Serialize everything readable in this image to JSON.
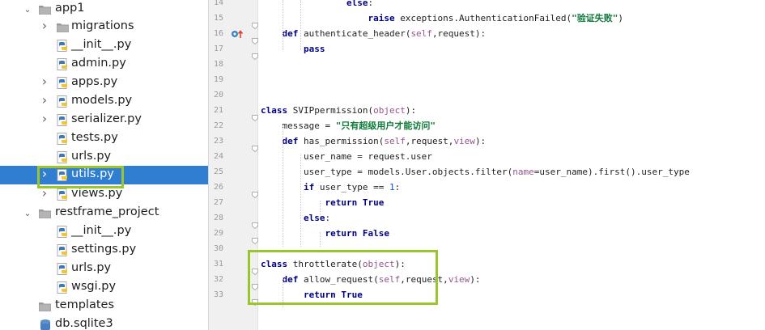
{
  "tree": {
    "items": [
      {
        "label": "app1",
        "icon": "folder-icon",
        "chevron": "expanded"
      },
      {
        "label": "migrations",
        "icon": "folder-icon",
        "chevron": "collapsed"
      },
      {
        "label": "__init__.py",
        "icon": "python-file-icon",
        "chevron": "none"
      },
      {
        "label": "admin.py",
        "icon": "python-file-icon",
        "chevron": "none"
      },
      {
        "label": "apps.py",
        "icon": "python-file-icon",
        "chevron": "collapsed"
      },
      {
        "label": "models.py",
        "icon": "python-file-icon",
        "chevron": "collapsed"
      },
      {
        "label": "serializer.py",
        "icon": "python-file-icon",
        "chevron": "collapsed"
      },
      {
        "label": "tests.py",
        "icon": "python-file-icon",
        "chevron": "none"
      },
      {
        "label": "urls.py",
        "icon": "python-file-icon",
        "chevron": "none"
      },
      {
        "label": "utils.py",
        "icon": "python-file-icon",
        "chevron": "collapsed",
        "selected": true
      },
      {
        "label": "views.py",
        "icon": "python-file-icon",
        "chevron": "collapsed"
      },
      {
        "label": "restframe_project",
        "icon": "folder-icon",
        "chevron": "expanded"
      },
      {
        "label": "__init__.py",
        "icon": "python-file-icon",
        "chevron": "none"
      },
      {
        "label": "settings.py",
        "icon": "python-file-icon",
        "chevron": "none"
      },
      {
        "label": "urls.py",
        "icon": "python-file-icon",
        "chevron": "none"
      },
      {
        "label": "wsgi.py",
        "icon": "python-file-icon",
        "chevron": "none"
      },
      {
        "label": "templates",
        "icon": "folder-icon",
        "chevron": "none"
      },
      {
        "label": "db.sqlite3",
        "icon": "database-icon",
        "chevron": "none"
      }
    ]
  },
  "editor": {
    "lines": [
      {
        "n": "14",
        "indent": 0,
        "tokens": [
          {
            "t": "                else",
            "c": "kw"
          },
          {
            "t": ":",
            "c": ""
          }
        ]
      },
      {
        "n": "15",
        "indent": 0,
        "tokens": [
          {
            "t": "                    raise ",
            "c": "kw"
          },
          {
            "t": "exceptions.AuthenticationFailed(",
            "c": ""
          },
          {
            "t": "\"验证失败\"",
            "c": "str"
          },
          {
            "t": ")",
            "c": ""
          }
        ]
      },
      {
        "n": "16",
        "indent": 0,
        "tokens": [
          {
            "t": "    def ",
            "c": "kw"
          },
          {
            "t": "authenticate_header(",
            "c": ""
          },
          {
            "t": "self",
            "c": "param"
          },
          {
            "t": ",request):",
            "c": ""
          }
        ]
      },
      {
        "n": "17",
        "indent": 0,
        "tokens": [
          {
            "t": "        pass",
            "c": "kw"
          }
        ]
      },
      {
        "n": "18",
        "indent": 0,
        "tokens": []
      },
      {
        "n": "19",
        "indent": 0,
        "tokens": []
      },
      {
        "n": "20",
        "indent": 0,
        "tokens": []
      },
      {
        "n": "21",
        "indent": 0,
        "tokens": [
          {
            "t": "class ",
            "c": "kw"
          },
          {
            "t": "SVIPpermission(",
            "c": ""
          },
          {
            "t": "object",
            "c": "param"
          },
          {
            "t": "):",
            "c": ""
          }
        ]
      },
      {
        "n": "22",
        "indent": 0,
        "tokens": [
          {
            "t": "    message = ",
            "c": ""
          },
          {
            "t": "\"只有超级用户才能访问\"",
            "c": "str"
          }
        ]
      },
      {
        "n": "23",
        "indent": 0,
        "tokens": [
          {
            "t": "    def ",
            "c": "kw"
          },
          {
            "t": "has_permission(",
            "c": ""
          },
          {
            "t": "self",
            "c": "param"
          },
          {
            "t": ",request,",
            "c": ""
          },
          {
            "t": "view",
            "c": "param"
          },
          {
            "t": "):",
            "c": ""
          }
        ]
      },
      {
        "n": "24",
        "indent": 0,
        "tokens": [
          {
            "t": "        user_name = request.user",
            "c": ""
          }
        ]
      },
      {
        "n": "25",
        "indent": 0,
        "tokens": [
          {
            "t": "        user_type = models.User.objects.filter(",
            "c": ""
          },
          {
            "t": "name",
            "c": "param"
          },
          {
            "t": "=user_name).first().user_type",
            "c": ""
          }
        ]
      },
      {
        "n": "26",
        "indent": 0,
        "tokens": [
          {
            "t": "        if ",
            "c": "kw"
          },
          {
            "t": "user_type == ",
            "c": ""
          },
          {
            "t": "1",
            "c": "num"
          },
          {
            "t": ":",
            "c": ""
          }
        ]
      },
      {
        "n": "27",
        "indent": 0,
        "tokens": [
          {
            "t": "            return True",
            "c": "kw"
          }
        ]
      },
      {
        "n": "28",
        "indent": 0,
        "tokens": [
          {
            "t": "        else",
            "c": "kw"
          },
          {
            "t": ":",
            "c": ""
          }
        ]
      },
      {
        "n": "29",
        "indent": 0,
        "tokens": [
          {
            "t": "            return False",
            "c": "kw"
          }
        ]
      },
      {
        "n": "30",
        "indent": 0,
        "tokens": []
      },
      {
        "n": "31",
        "indent": 0,
        "tokens": [
          {
            "t": "class ",
            "c": "kw"
          },
          {
            "t": "throttlerate(",
            "c": ""
          },
          {
            "t": "object",
            "c": "param"
          },
          {
            "t": "):",
            "c": ""
          }
        ]
      },
      {
        "n": "32",
        "indent": 0,
        "tokens": [
          {
            "t": "    def ",
            "c": "kw"
          },
          {
            "t": "allow_request(",
            "c": ""
          },
          {
            "t": "self",
            "c": "param"
          },
          {
            "t": ",request,",
            "c": ""
          },
          {
            "t": "view",
            "c": "param"
          },
          {
            "t": "):",
            "c": ""
          }
        ]
      },
      {
        "n": "33",
        "indent": 0,
        "tokens": [
          {
            "t": "        return True",
            "c": "kw"
          }
        ]
      }
    ]
  },
  "colors": {
    "selection": "#2f7ed2",
    "highlight_box": "#9ac52b",
    "keyword": "#000080",
    "string": "#0f7a3b",
    "param": "#94558d",
    "number": "#1750eb"
  }
}
